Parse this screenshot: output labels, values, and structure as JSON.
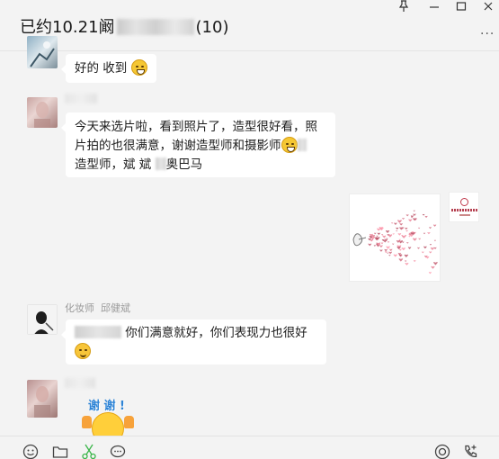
{
  "window": {
    "title_prefix": "已约10.21阚",
    "title_suffix": "(10)",
    "controls": {
      "pin": "⇲",
      "minimize": "—",
      "maximize": "☐",
      "close": "✕"
    },
    "more": "···"
  },
  "messages": [
    {
      "text": "好的  收到"
    },
    {
      "line1": "今天来选片啦，看到照片了，造型很好看，照",
      "line2": "片拍的也很满意，谢谢造型师和摄影师",
      "line3_a": "造型师，斌 斌",
      "line3_b": "奥巴马"
    },
    {
      "type": "image"
    },
    {
      "sender_role": "化妆师",
      "sender_name": "邱健斌",
      "text": "你们满意就好，你们表现力也很好"
    },
    {
      "sticker_text": "谢 谢 !"
    }
  ],
  "toolbar": {
    "icons": [
      "emoji-icon",
      "folder-icon",
      "scissors-icon",
      "chat-bubble-icon",
      "live-icon",
      "phone-icon"
    ]
  },
  "colors": {
    "background": "#f3f3f3",
    "bubble": "#ffffff",
    "text": "#1c1c1c",
    "sender": "#9a9a9a",
    "scissors": "#3bb54a"
  }
}
